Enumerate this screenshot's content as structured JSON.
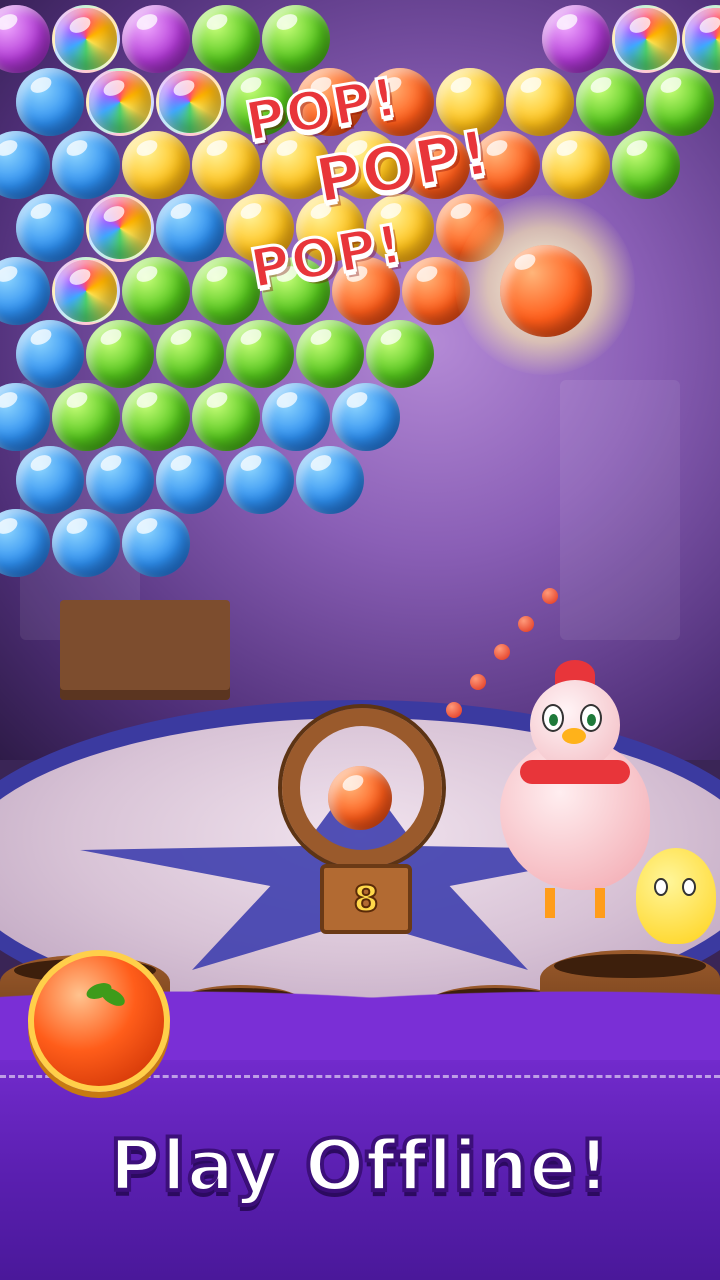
{
  "game": {
    "effects": {
      "pop_words": [
        "POP!",
        "POP!",
        "POP!"
      ]
    },
    "shooter": {
      "shots_remaining": "8",
      "loaded_bubble": "tomato-orange"
    },
    "next_bubble": "tomato-orange",
    "headline": "Play Offline!",
    "bubble_colors": {
      "blue": "#2e8ff0",
      "green": "#55c61d",
      "yellow": "#ffc21a",
      "orange": "#ff5d1a",
      "purple": "#b23ad6"
    },
    "characters": [
      "hen",
      "chick"
    ]
  }
}
